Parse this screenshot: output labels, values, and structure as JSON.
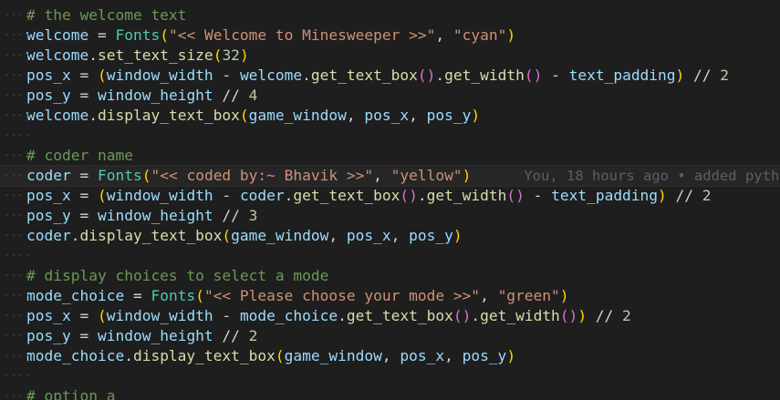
{
  "colors": {
    "background": "#1e1e1e",
    "comment": "#6a9955",
    "variable": "#9cdcfe",
    "class": "#4ec9b0",
    "function": "#dcdcaa",
    "string": "#ce9178",
    "number": "#b5cea8",
    "bracket_level1": "#ffd700",
    "bracket_level2": "#da70d6",
    "bracket_level3": "#179fff",
    "blame": "#5f5f5f"
  },
  "editor": {
    "current_line_index": 8,
    "lines": [
      {
        "tokens": [
          [
            "c-comment",
            "# the welcome text"
          ]
        ]
      },
      {
        "tokens": [
          [
            "c-var",
            "welcome"
          ],
          [
            "c-op",
            " = "
          ],
          [
            "c-class",
            "Fonts"
          ],
          [
            "c-p1",
            "("
          ],
          [
            "c-str",
            "\"<< Welcome to Minesweeper >>\""
          ],
          [
            "c-punct",
            ", "
          ],
          [
            "c-str",
            "\"cyan\""
          ],
          [
            "c-p1",
            ")"
          ]
        ]
      },
      {
        "tokens": [
          [
            "c-var",
            "welcome"
          ],
          [
            "c-punct",
            "."
          ],
          [
            "c-func",
            "set_text_size"
          ],
          [
            "c-p1",
            "("
          ],
          [
            "c-num",
            "32"
          ],
          [
            "c-p1",
            ")"
          ]
        ]
      },
      {
        "tokens": [
          [
            "c-var",
            "pos_x"
          ],
          [
            "c-op",
            " = "
          ],
          [
            "c-p1",
            "("
          ],
          [
            "c-var",
            "window_width"
          ],
          [
            "c-op",
            " - "
          ],
          [
            "c-var",
            "welcome"
          ],
          [
            "c-punct",
            "."
          ],
          [
            "c-func",
            "get_text_box"
          ],
          [
            "c-p2",
            "()"
          ],
          [
            "c-punct",
            "."
          ],
          [
            "c-func",
            "get_width"
          ],
          [
            "c-p2",
            "()"
          ],
          [
            "c-op",
            " - "
          ],
          [
            "c-var",
            "text_padding"
          ],
          [
            "c-p1",
            ")"
          ],
          [
            "c-op",
            " // "
          ],
          [
            "c-num",
            "2"
          ]
        ]
      },
      {
        "tokens": [
          [
            "c-var",
            "pos_y"
          ],
          [
            "c-op",
            " = "
          ],
          [
            "c-var",
            "window_height"
          ],
          [
            "c-op",
            " // "
          ],
          [
            "c-num",
            "4"
          ]
        ]
      },
      {
        "tokens": [
          [
            "c-var",
            "welcome"
          ],
          [
            "c-punct",
            "."
          ],
          [
            "c-func",
            "display_text_box"
          ],
          [
            "c-p1",
            "("
          ],
          [
            "c-var",
            "game_window"
          ],
          [
            "c-punct",
            ", "
          ],
          [
            "c-var",
            "pos_x"
          ],
          [
            "c-punct",
            ", "
          ],
          [
            "c-var",
            "pos_y"
          ],
          [
            "c-p1",
            ")"
          ]
        ]
      },
      {
        "tokens": []
      },
      {
        "tokens": [
          [
            "c-comment",
            "# coder name"
          ]
        ]
      },
      {
        "tokens": [
          [
            "c-var",
            "coder"
          ],
          [
            "c-op",
            " = "
          ],
          [
            "c-class",
            "Fonts"
          ],
          [
            "c-p1",
            "("
          ],
          [
            "c-str",
            "\"<< coded by:~ Bhavik >>\""
          ],
          [
            "c-punct",
            ", "
          ],
          [
            "c-str",
            "\"yellow\""
          ],
          [
            "c-p1",
            ")"
          ]
        ],
        "blame": "You, 18 hours ago • added pyth"
      },
      {
        "tokens": [
          [
            "c-var",
            "pos_x"
          ],
          [
            "c-op",
            " = "
          ],
          [
            "c-p1",
            "("
          ],
          [
            "c-var",
            "window_width"
          ],
          [
            "c-op",
            " - "
          ],
          [
            "c-var",
            "coder"
          ],
          [
            "c-punct",
            "."
          ],
          [
            "c-func",
            "get_text_box"
          ],
          [
            "c-p2",
            "()"
          ],
          [
            "c-punct",
            "."
          ],
          [
            "c-func",
            "get_width"
          ],
          [
            "c-p2",
            "()"
          ],
          [
            "c-op",
            " - "
          ],
          [
            "c-var",
            "text_padding"
          ],
          [
            "c-p1",
            ")"
          ],
          [
            "c-op",
            " // "
          ],
          [
            "c-num",
            "2"
          ]
        ]
      },
      {
        "tokens": [
          [
            "c-var",
            "pos_y"
          ],
          [
            "c-op",
            " = "
          ],
          [
            "c-var",
            "window_height"
          ],
          [
            "c-op",
            " // "
          ],
          [
            "c-num",
            "3"
          ]
        ]
      },
      {
        "tokens": [
          [
            "c-var",
            "coder"
          ],
          [
            "c-punct",
            "."
          ],
          [
            "c-func",
            "display_text_box"
          ],
          [
            "c-p1",
            "("
          ],
          [
            "c-var",
            "game_window"
          ],
          [
            "c-punct",
            ", "
          ],
          [
            "c-var",
            "pos_x"
          ],
          [
            "c-punct",
            ", "
          ],
          [
            "c-var",
            "pos_y"
          ],
          [
            "c-p1",
            ")"
          ]
        ]
      },
      {
        "tokens": []
      },
      {
        "tokens": [
          [
            "c-comment",
            "# display choices to select a mode"
          ]
        ]
      },
      {
        "tokens": [
          [
            "c-var",
            "mode_choice"
          ],
          [
            "c-op",
            " = "
          ],
          [
            "c-class",
            "Fonts"
          ],
          [
            "c-p1",
            "("
          ],
          [
            "c-str",
            "\"<< Please choose your mode >>\""
          ],
          [
            "c-punct",
            ", "
          ],
          [
            "c-str",
            "\"green\""
          ],
          [
            "c-p1",
            ")"
          ]
        ]
      },
      {
        "tokens": [
          [
            "c-var",
            "pos_x"
          ],
          [
            "c-op",
            " = "
          ],
          [
            "c-p1",
            "("
          ],
          [
            "c-var",
            "window_width"
          ],
          [
            "c-op",
            " - "
          ],
          [
            "c-var",
            "mode_choice"
          ],
          [
            "c-punct",
            "."
          ],
          [
            "c-func",
            "get_text_box"
          ],
          [
            "c-p2",
            "()"
          ],
          [
            "c-punct",
            "."
          ],
          [
            "c-func",
            "get_width"
          ],
          [
            "c-p2",
            "()"
          ],
          [
            "c-p1",
            ")"
          ],
          [
            "c-op",
            " // "
          ],
          [
            "c-num",
            "2"
          ]
        ]
      },
      {
        "tokens": [
          [
            "c-var",
            "pos_y"
          ],
          [
            "c-op",
            " = "
          ],
          [
            "c-var",
            "window_height"
          ],
          [
            "c-op",
            " // "
          ],
          [
            "c-num",
            "2"
          ]
        ]
      },
      {
        "tokens": [
          [
            "c-var",
            "mode_choice"
          ],
          [
            "c-punct",
            "."
          ],
          [
            "c-func",
            "display_text_box"
          ],
          [
            "c-p1",
            "("
          ],
          [
            "c-var",
            "game_window"
          ],
          [
            "c-punct",
            ", "
          ],
          [
            "c-var",
            "pos_x"
          ],
          [
            "c-punct",
            ", "
          ],
          [
            "c-var",
            "pos_y"
          ],
          [
            "c-p1",
            ")"
          ]
        ]
      },
      {
        "tokens": []
      },
      {
        "tokens": [
          [
            "c-comment",
            "# option a"
          ]
        ]
      }
    ]
  }
}
